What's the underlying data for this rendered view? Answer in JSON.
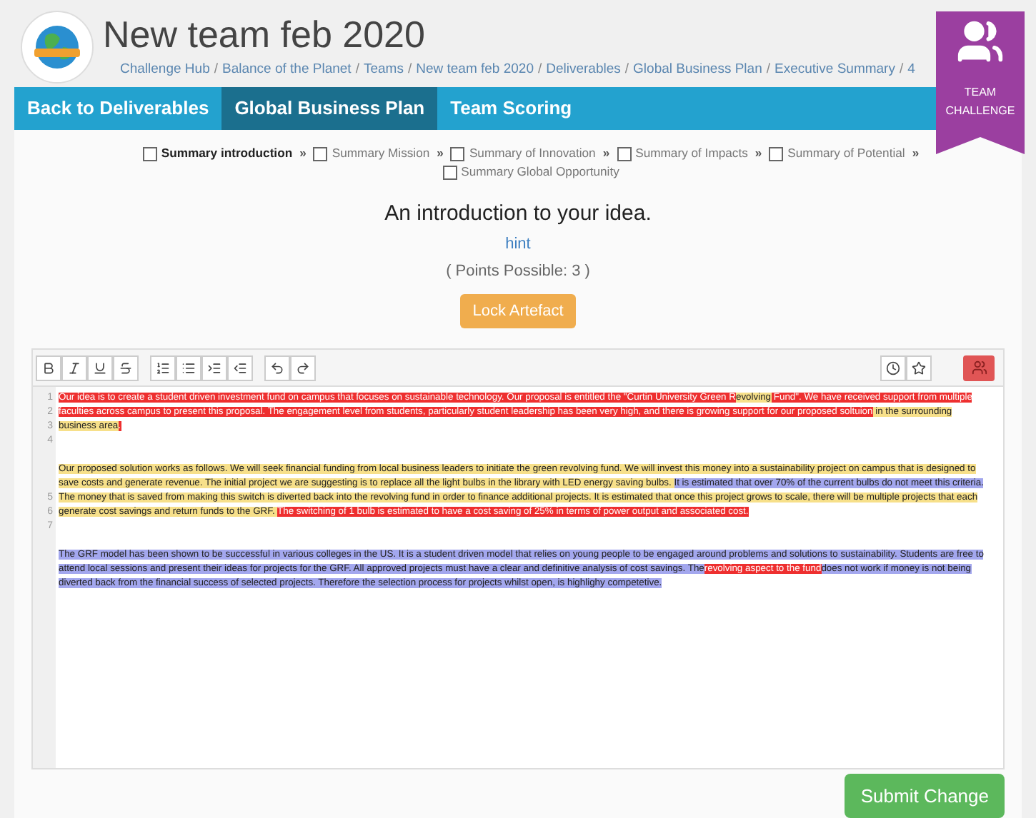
{
  "header": {
    "title": "New team feb 2020",
    "breadcrumb_separator": "/",
    "breadcrumbs": [
      "Challenge Hub",
      "Balance of the Planet",
      "Teams",
      "New team feb 2020",
      "Deliverables",
      "Global Business Plan",
      "Executive Summary",
      "4"
    ]
  },
  "badge": {
    "label": "TEAM CHALLENGE"
  },
  "nav": [
    {
      "label": "Back to Deliverables",
      "selected": false
    },
    {
      "label": "Global Business Plan",
      "selected": true
    },
    {
      "label": "Team Scoring",
      "selected": false
    }
  ],
  "steps": [
    {
      "label": "Summary introduction",
      "checked": false,
      "selected": true
    },
    {
      "label": "Summary Mission",
      "checked": false,
      "selected": false
    },
    {
      "label": "Summary of Innovation",
      "checked": false,
      "selected": false
    },
    {
      "label": "Summary of Impacts",
      "checked": false,
      "selected": false
    },
    {
      "label": "Summary of Potential",
      "checked": false,
      "selected": false
    },
    {
      "label": "Summary Global Opportunity",
      "checked": false,
      "selected": false
    }
  ],
  "step_separator": "»",
  "question": {
    "title": "An introduction to your idea.",
    "hint": "hint",
    "points": "( Points Possible: 3 )",
    "lock_button": "Lock Artefact"
  },
  "editor": {
    "blocks": [
      {
        "kind": "text",
        "numbers": [
          "1",
          "2",
          "3"
        ],
        "segments": [
          {
            "text": "Our idea is to create a student driven investment fund on campus that focuses on sustainable technology. Our proposal is entitled the \"Curtin University Green R",
            "color": "#ee2f2f"
          },
          {
            "text": "evolving",
            "color": "#f7e08a"
          },
          {
            "text": " Fund\". We have received support from multiple faculties across campus to present this proposal. The engagement level from students, particularly student leadership has been very high, and there is growing support for our proposed soltuion",
            "color": "#ee2f2f"
          },
          {
            "text": " in the surrounding business area",
            "color": "#f7e08a"
          },
          {
            "text": ".",
            "color": "#ee2f2f"
          }
        ]
      },
      {
        "kind": "blank",
        "numbers": [
          "4"
        ]
      },
      {
        "kind": "text_numbered_at_end",
        "numbers": [
          "5",
          "6"
        ],
        "segments": [
          {
            "text": "Our proposed solution works as follows. We will seek financial funding from local business leaders to initiate the green revolving fund. We will invest this money into a sustainability project on campus that is designed to save costs and generate revenue. The initial project we are suggesting is to replace all the light bulbs in the library with LED energy saving bulbs. ",
            "color": "#f7e08a"
          },
          {
            "text": "It is estimated that over 70% of the current bulbs do not meet this criteria.",
            "color": "#a3a7ee"
          },
          {
            "text": " The money that is saved from making this switch is diverted back into the revolving fund in order to finance additional projects. It is estimated that once this project grows to scale, there will be multiple projects that each generate cost savings and return funds to the GRF. ",
            "color": "#f7e08a"
          },
          {
            "text": "The switching of 1 bulb is estimated to have a cost saving of 25% in terms of power output and associated cost.",
            "color": "#ee2f2f"
          }
        ]
      },
      {
        "kind": "blank",
        "numbers": [
          "7"
        ]
      },
      {
        "kind": "text",
        "segments": [
          {
            "text": "The GRF model has been shown to be successful in various colleges in the US. It is a student driven model that relies on young people to be engaged around problems and solutions to sustainability. Students are free to attend local sessions and present their ideas for projects for the GRF. All approved projects must have a clear and definitive analysis of cost savings. The",
            "color": "#a3a7ee"
          },
          {
            "text": "revolving aspect to the fund",
            "color": "#ee2f2f"
          },
          {
            "text": "does not work if money is not being diverted back from the financial success of selected projects. Therefore the selection process for projects whilst open, is highlighy competetive.",
            "color": "#a3a7ee"
          }
        ]
      }
    ]
  },
  "submit_button": "Submit Change"
}
